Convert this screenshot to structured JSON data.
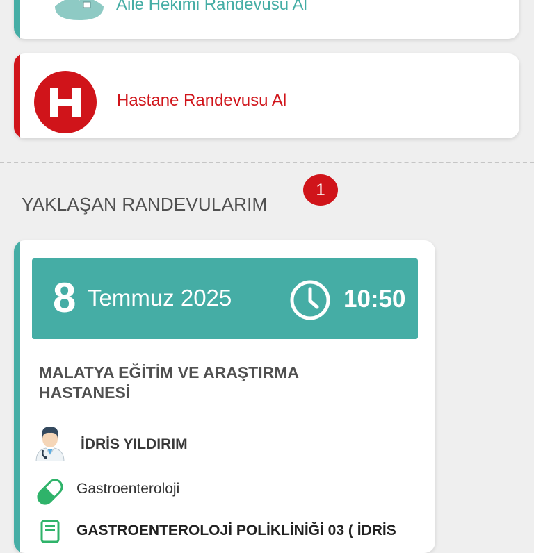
{
  "cards": {
    "family_doctor": {
      "label": "Aile Hekimi Randevusu Al",
      "icon": "doctor-avatar-icon",
      "accent": "#45ada5"
    },
    "hospital": {
      "label": "Hastane Randevusu Al",
      "icon_letter": "H",
      "accent": "#d0141a"
    }
  },
  "upcoming": {
    "title": "YAKLAŞAN RANDEVULARIM",
    "count": "1"
  },
  "appointment": {
    "day": "8",
    "month_year": "Temmuz 2025",
    "time": "10:50",
    "hospital": "MALATYA EĞİTİM VE ARAŞTIRMA HASTANESİ",
    "doctor": "İDRİS YILDIRIM",
    "department": "Gastroenteroloji",
    "clinic": "GASTROENTEROLOJİ POLİKLİNİĞİ 03 ( İDRİS"
  },
  "icons": {
    "doctor": "doctor-icon",
    "department": "pill-icon",
    "clinic": "clinic-board-icon",
    "time": "clock-icon"
  },
  "colors": {
    "teal": "#45ada5",
    "red": "#d0141a",
    "background": "#efefef"
  }
}
